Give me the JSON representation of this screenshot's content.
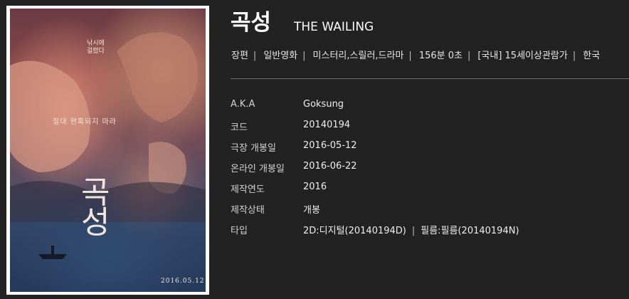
{
  "poster": {
    "tagline_line1": "낚시에",
    "tagline_line2": "걸렸다",
    "tagline_mid": "절대 현혹되지 마라",
    "title": "곡성",
    "date": "2016.05.12"
  },
  "title": {
    "korean": "곡성",
    "english": "THE WAILING"
  },
  "meta": [
    "장편",
    "일반영화",
    "미스터리,스릴러,드라마",
    "156분 0초",
    "[국내] 15세이상관람가",
    "한국"
  ],
  "meta_separator": "|",
  "info": {
    "aka": {
      "label": "A.K.A",
      "value": "Goksung"
    },
    "code": {
      "label": "코드",
      "value": "20140194"
    },
    "theatrical_release": {
      "label": "극장 개봉일",
      "value": "2016-05-12"
    },
    "online_release": {
      "label": "온라인 개봉일",
      "value": "2016-06-22"
    },
    "production_year": {
      "label": "제작연도",
      "value": "2016"
    },
    "production_status": {
      "label": "제작상태",
      "value": "개봉"
    },
    "type": {
      "label": "타입",
      "value_digital": "2D:디지털(20140194D)",
      "separator": "|",
      "value_film": "필름:필름(20140194N)"
    }
  }
}
